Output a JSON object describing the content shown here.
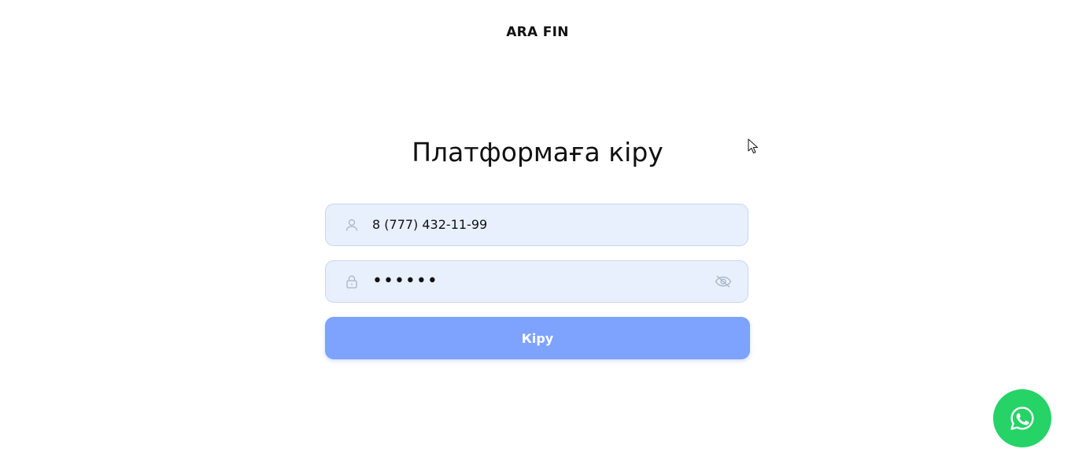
{
  "header": {
    "brand": "ARA FIN"
  },
  "login": {
    "title": "Платформаға кіру",
    "phone": {
      "value": "8 (777) 432-11-99",
      "icon": "user-icon"
    },
    "password": {
      "masked_value": "••••••",
      "icon": "lock-icon",
      "toggle_icon": "eye-off-icon"
    },
    "submit_label": "Кіру"
  },
  "floating": {
    "whatsapp_icon": "whatsapp-icon"
  },
  "colors": {
    "input_bg": "#e8f0fe",
    "button_bg": "#7ea3fe",
    "whatsapp": "#25d366"
  }
}
